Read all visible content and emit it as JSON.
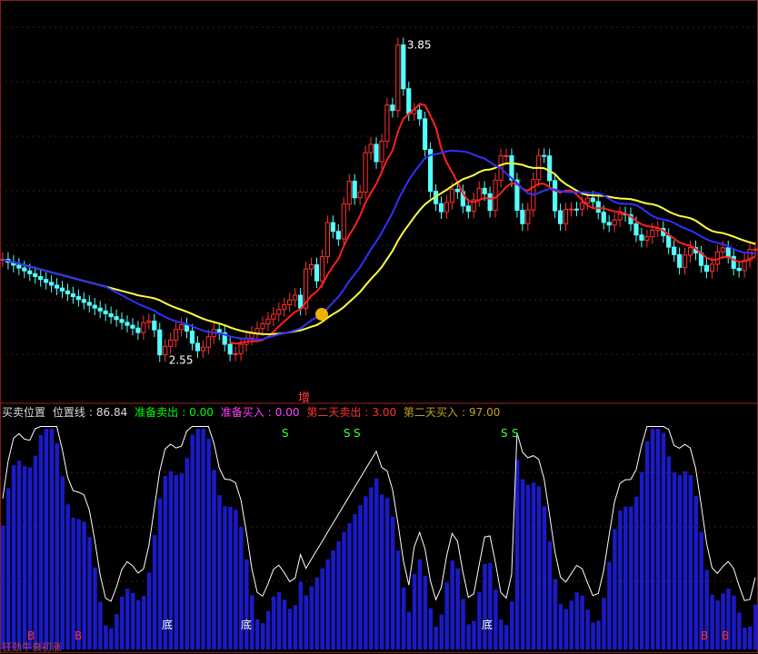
{
  "chart_data": [
    {
      "type": "candlestick",
      "title": "",
      "price_high_label": "3.85",
      "price_low_label": "2.55",
      "signal_label": "增",
      "colors": {
        "up": "#ff3232",
        "down": "#54ffff",
        "ma_fast": "#ff2020",
        "ma_mid": "#ffff40",
        "ma_slow": "#3030ff"
      },
      "candles_summary": "approx 140 daily bars rising from ~2.55 to peak 3.85 then declining",
      "ylim": [
        2.4,
        4.0
      ]
    },
    {
      "type": "bar",
      "panel_title": "买卖位置",
      "legend": [
        {
          "label": "位置线",
          "value": "86.84",
          "color": "#ffffff"
        },
        {
          "label": "准备卖出",
          "value": "0.00",
          "color": "#00ff00"
        },
        {
          "label": "准备买入",
          "value": "0.00",
          "color": "#ff40ff"
        },
        {
          "label": "第二天卖出",
          "value": "3.00",
          "color": "#ff3030"
        },
        {
          "label": "第二天买入",
          "value": "97.00",
          "color": "#c0a020"
        }
      ],
      "markers": {
        "sell": "S",
        "buy": "B",
        "bottom": "底"
      },
      "ylim": [
        0,
        100
      ]
    }
  ],
  "footer": {
    "label": "狂劲牛衰初涨"
  }
}
